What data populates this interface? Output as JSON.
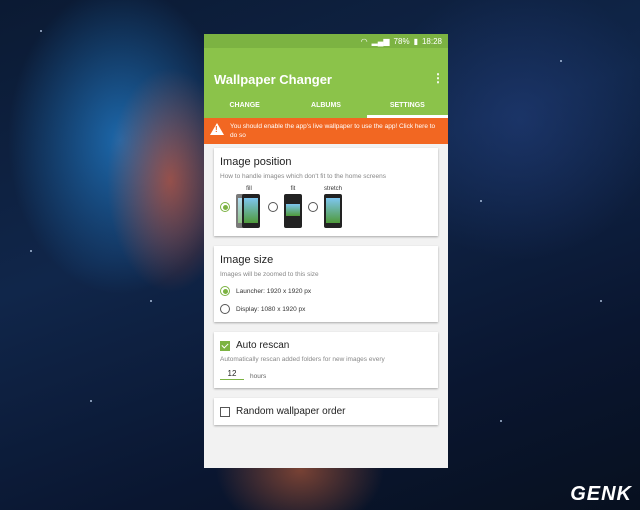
{
  "status": {
    "battery": "78%",
    "time": "18:28"
  },
  "app": {
    "title": "Wallpaper Changer",
    "tabs": [
      {
        "label": "CHANGE"
      },
      {
        "label": "ALBUMS"
      },
      {
        "label": "SETTINGS"
      }
    ]
  },
  "banner": {
    "text": "You should enable the app's live wallpaper to use the app! Click here to do so"
  },
  "image_position": {
    "title": "Image position",
    "subtitle": "How to handle images which don't fit to the home screens",
    "options": [
      {
        "label": "fill"
      },
      {
        "label": "fit"
      },
      {
        "label": "stretch"
      }
    ]
  },
  "image_size": {
    "title": "Image size",
    "subtitle": "Images will be zoomed to this size",
    "options": [
      {
        "label": "Launcher: 1920 x 1920 px"
      },
      {
        "label": "Display: 1080 x 1920 px"
      }
    ]
  },
  "auto_rescan": {
    "title": "Auto rescan",
    "subtitle": "Automatically rescan added folders for new images every",
    "value": "12",
    "unit": "hours"
  },
  "random_order": {
    "title": "Random wallpaper order"
  },
  "watermark": {
    "text": "GENK"
  },
  "colors": {
    "accent": "#8bc34a",
    "banner": "#f26722"
  }
}
